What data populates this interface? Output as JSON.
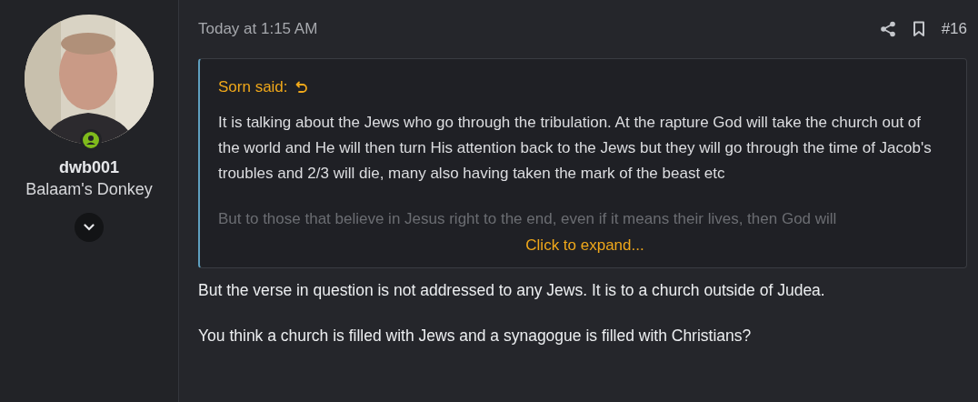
{
  "user": {
    "online": true,
    "name": "dwb001",
    "title": "Balaam's Donkey"
  },
  "post": {
    "time": "Today at 1:15 AM",
    "number": "#16",
    "quote": {
      "author": "Sorn said:",
      "paragraphs": [
        "It is talking about the Jews who go through the tribulation. At the rapture God will take the church out of the world and He will then turn His attention back to the Jews but they will go through the time of Jacob's troubles and 2/3 will die, many also having taken the mark of the beast etc",
        "But to those that believe in Jesus right to the end, even if it means their lives, then God will"
      ],
      "expand": "Click to expand..."
    },
    "body": [
      "But the verse in question is not addressed to any Jews. It is to a church outside of Judea.",
      "You think a church is filled with Jews and a synagogue is filled with Christians?"
    ]
  }
}
